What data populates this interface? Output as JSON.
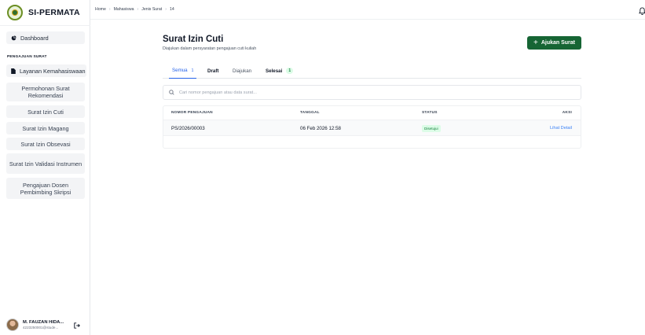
{
  "app": {
    "name": "SI-PERMATA"
  },
  "breadcrumb": [
    "Home",
    "Mahasiswa",
    "Jenis Surat",
    "14"
  ],
  "sidebar": {
    "dashboard": "Dashboard",
    "section_label": "PENGAJUAN SURAT",
    "layanan": "Layanan Kemahasiswaan",
    "items": [
      {
        "label": "Permohonan Surat Rekomendasi"
      },
      {
        "label": "Surat Izin Cuti"
      },
      {
        "label": "Surat Izin Magang"
      },
      {
        "label": "Surat Izin Obsevasi"
      },
      {
        "label": "Surat Izin Validasi Instrumen"
      },
      {
        "label": "Pengajuan Dosen Pembimbing Skripsi"
      }
    ]
  },
  "user": {
    "name": "M. FAUZAN HIDA...",
    "email": "4223250001@stude..."
  },
  "page": {
    "title": "Surat Izin Cuti",
    "subtitle": "Diajukan dalam persyaratan pengajuan cuti kuliah",
    "primary_button": "Ajukan Surat"
  },
  "tabs": [
    {
      "label": "Semua",
      "count": "1",
      "active": true
    },
    {
      "label": "Draft",
      "count": ""
    },
    {
      "label": "Diajukan",
      "count": ""
    },
    {
      "label": "Selesai",
      "count": "1"
    }
  ],
  "search": {
    "placeholder": "Cari nomor pengajuan atau data surat...",
    "value": ""
  },
  "table": {
    "columns": [
      "NOMOR PENGAJUAN",
      "TANGGAL",
      "STATUS",
      "AKSI"
    ],
    "rows": [
      {
        "nomor": "PS/2026/00003",
        "tanggal": "06 Feb 2026 12:58",
        "status": "Disetujui",
        "aksi": "Lihat Detail"
      }
    ]
  },
  "colors": {
    "primary": "#166534",
    "accent": "#2563eb",
    "success_bg": "#dcfce7",
    "success_text": "#15803d"
  }
}
